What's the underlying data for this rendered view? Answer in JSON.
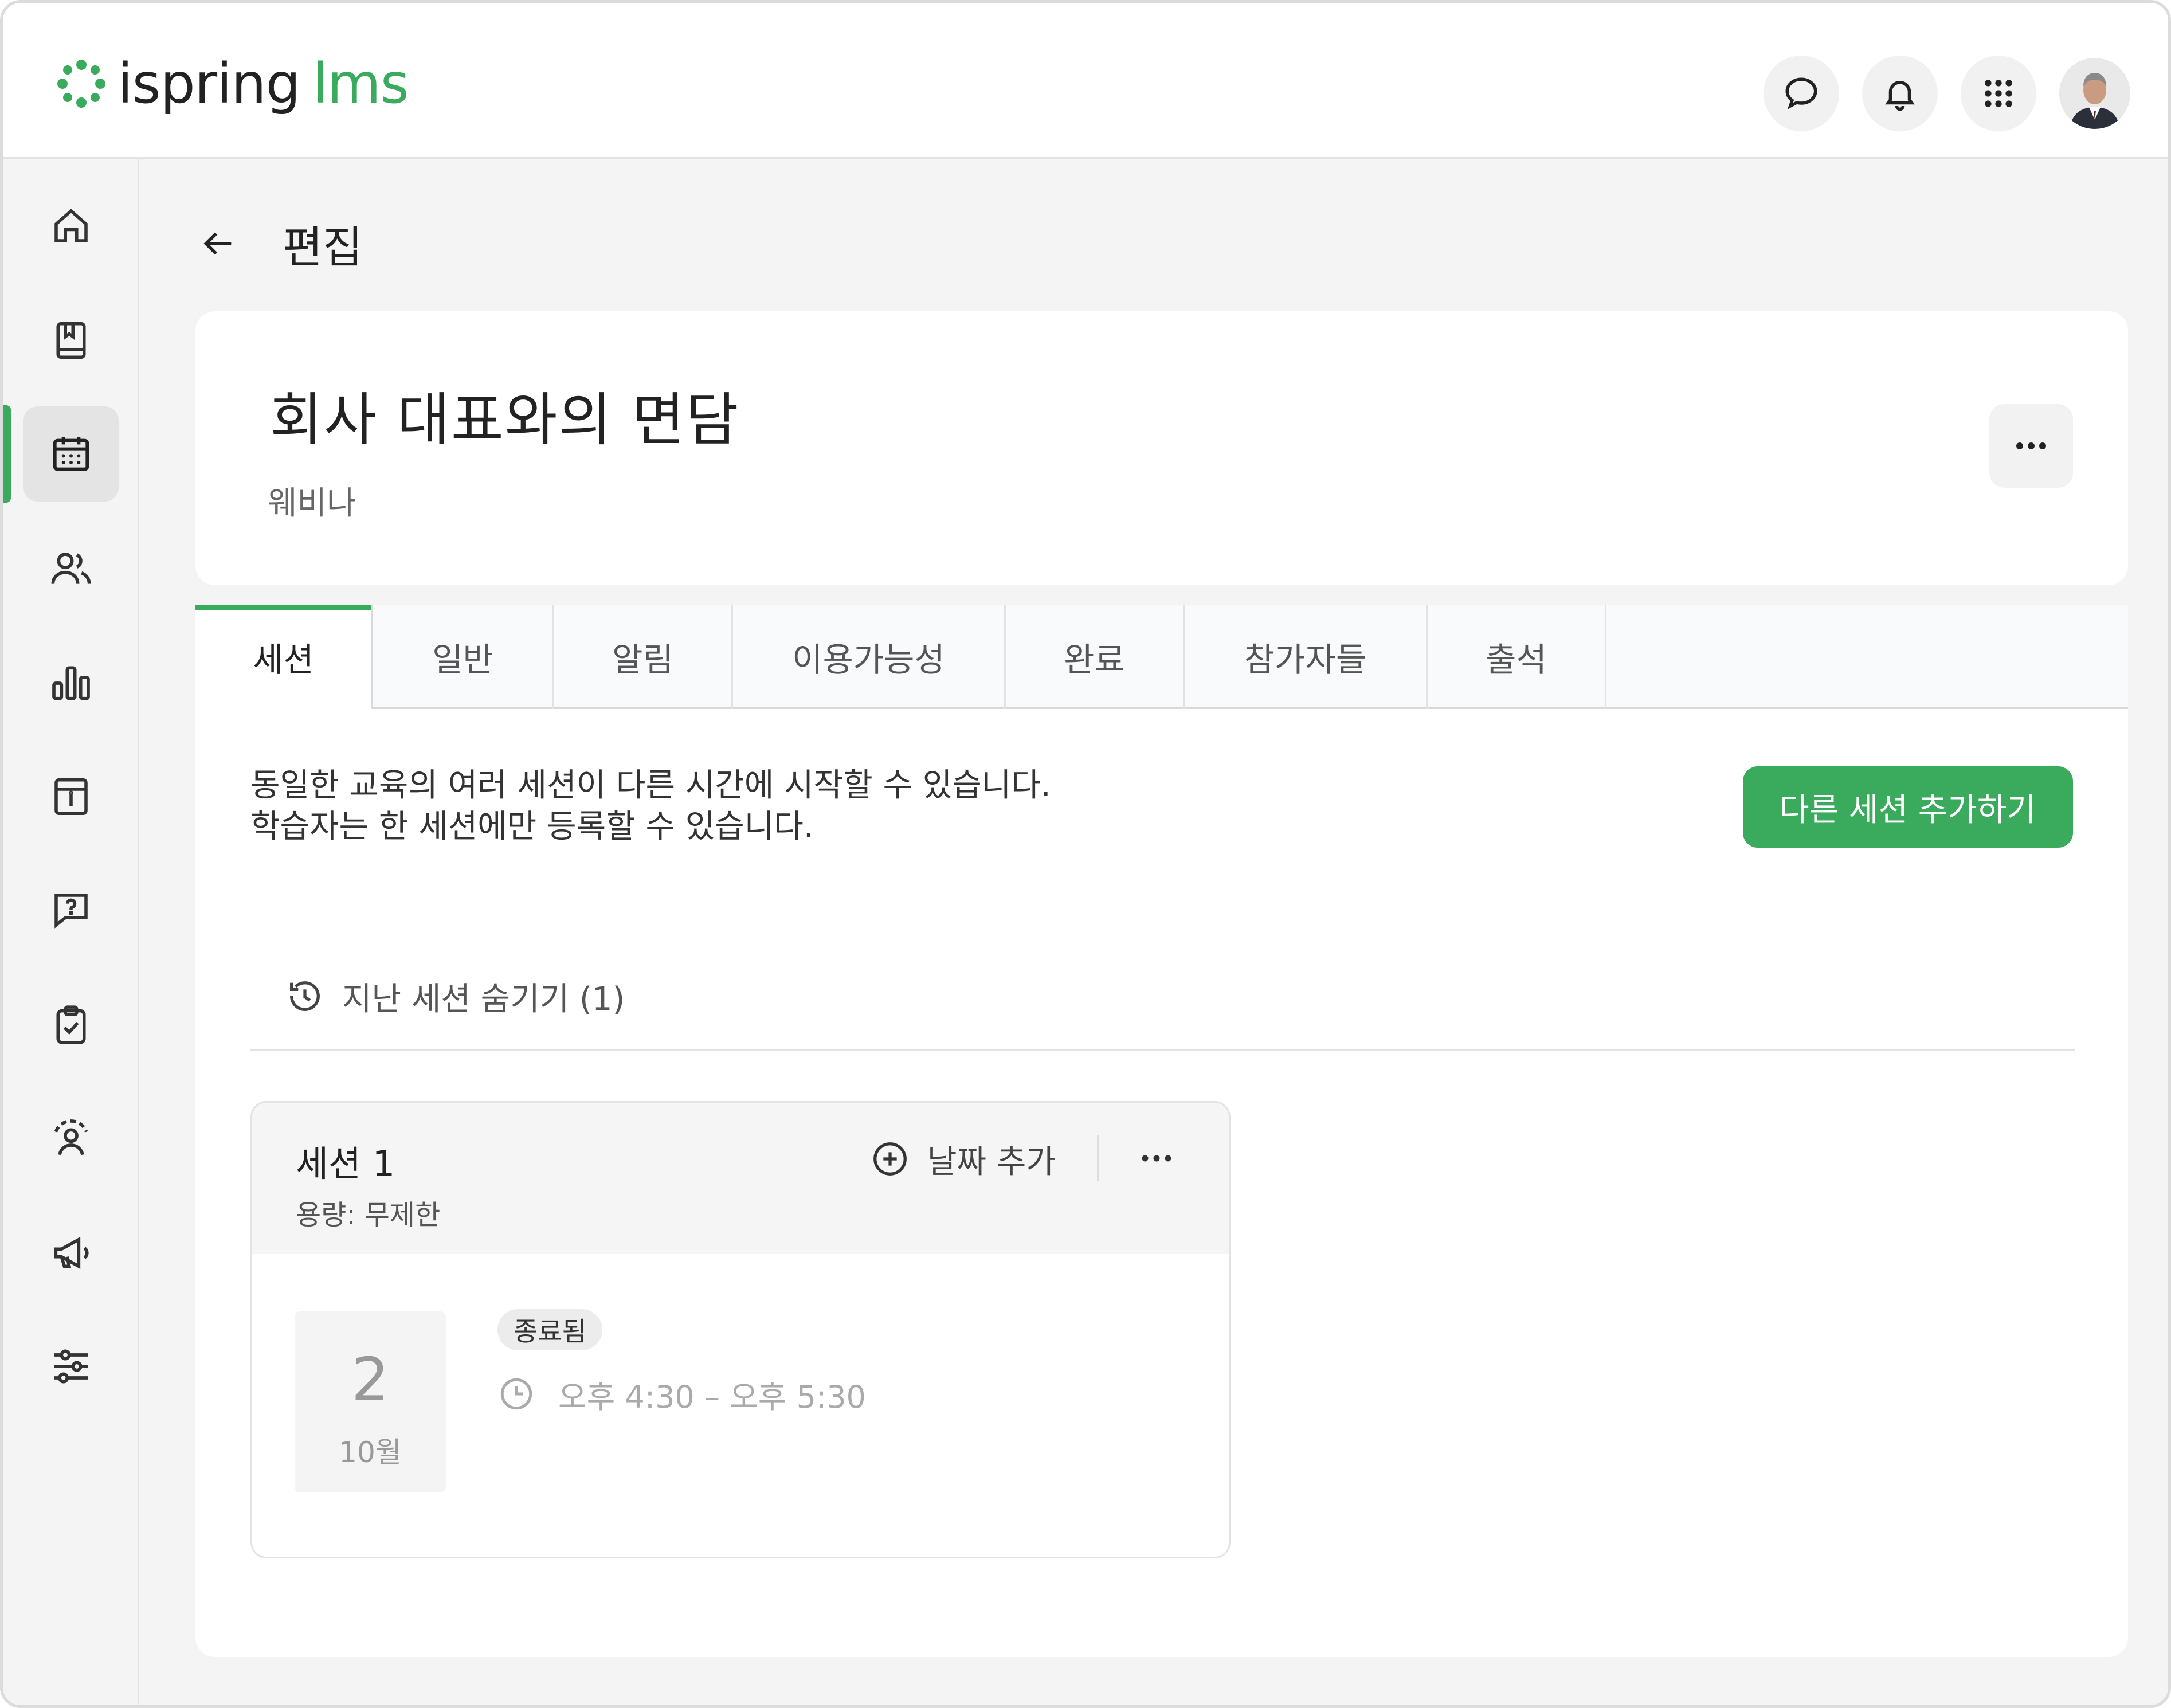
{
  "app": {
    "logo_word": "ispring",
    "logo_suffix": "lms",
    "brand_color": "#3aaa5c"
  },
  "topbar": {
    "icons": [
      "chat-icon",
      "bell-icon",
      "apps-grid-icon"
    ],
    "avatar": "user-avatar"
  },
  "sidebar": {
    "items": [
      {
        "icon": "home-icon"
      },
      {
        "icon": "book-icon"
      },
      {
        "icon": "calendar-icon",
        "active": true
      },
      {
        "icon": "users-icon"
      },
      {
        "icon": "bar-chart-icon"
      },
      {
        "icon": "info-page-icon"
      },
      {
        "icon": "question-chat-icon"
      },
      {
        "icon": "clipboard-check-icon"
      },
      {
        "icon": "user-gear-icon"
      },
      {
        "icon": "megaphone-icon"
      },
      {
        "icon": "sliders-icon"
      }
    ]
  },
  "header": {
    "back_label": "편집",
    "title": "회사 대표와의 면담",
    "subtitle": "웨비나"
  },
  "tabs": [
    {
      "label": "세션",
      "active": true
    },
    {
      "label": "일반"
    },
    {
      "label": "알림"
    },
    {
      "label": "이용가능성"
    },
    {
      "label": "완료"
    },
    {
      "label": "참가자들"
    },
    {
      "label": "출석"
    }
  ],
  "sessions_panel": {
    "description_line1": "동일한 교육의 여러 세션이 다른 시간에 시작할 수 있습니다.",
    "description_line2": "학습자는 한 세션에만 등록할 수 있습니다.",
    "add_button": "다른 세션 추가하기",
    "hide_past": "지난 세션 숨기기 (1)"
  },
  "session": {
    "title": "세션 1",
    "capacity": "용량: 무제한",
    "add_date": "날짜 추가",
    "day": "2",
    "month": "10월",
    "status": "종료됨",
    "time": "오후 4:30 – 오후 5:30"
  }
}
